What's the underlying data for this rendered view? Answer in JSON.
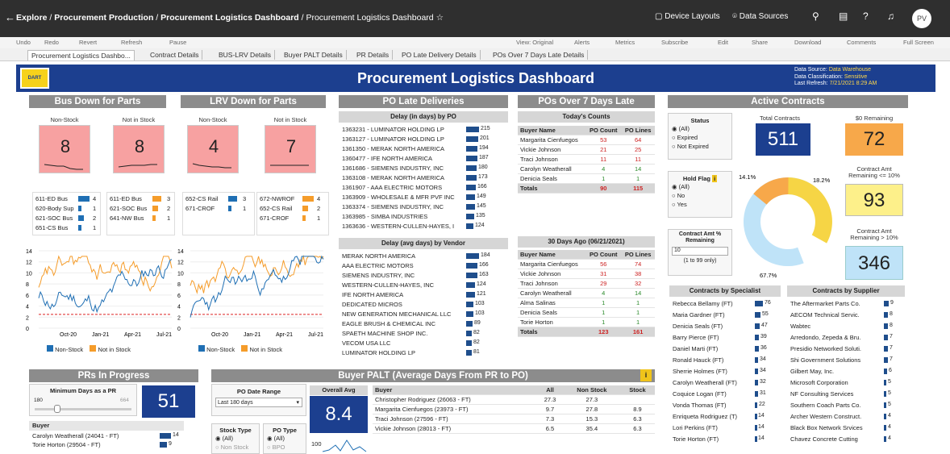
{
  "topbar": {
    "crumb1": "Explore",
    "crumb2": "Procurement Production",
    "crumb3": "Procurement Logistics Dashboard",
    "crumb4": "Procurement Logistics Dashboard",
    "device_layouts": "Device Layouts",
    "data_sources": "Data Sources",
    "avatar": "PV"
  },
  "toolbar": {
    "undo": "Undo",
    "redo": "Redo",
    "revert": "Revert",
    "refresh": "Refresh",
    "pause": "Pause",
    "view_original": "View: Original",
    "alerts": "Alerts",
    "metrics": "Metrics",
    "subscribe": "Subscribe",
    "edit": "Edit",
    "share": "Share",
    "download": "Download",
    "comments": "Comments",
    "full_screen": "Full Screen"
  },
  "tabs": [
    "Procurement Logistics Dashbo...",
    "Contract Details",
    "BUS-LRV Details",
    "Buyer PALT Details",
    "PR Details",
    "PO Late Delivery Details",
    "POs Over 7 Days Late Details"
  ],
  "banner": {
    "logo": "DART",
    "title": "Procurement Logistics Dashboard",
    "source_lbl": "Data Source:",
    "source": "Data Warehouse",
    "class_lbl": "Data Classification:",
    "class": "Sensitive",
    "refresh_lbl": "Last Refresh:",
    "refresh": "7/21/2021 8:29 AM"
  },
  "bus": {
    "title": "Bus Down for Parts",
    "nonstock_lbl": "Non-Stock",
    "notinstock_lbl": "Not in Stock",
    "nonstock": "8",
    "notinstock": "8",
    "list1": [
      [
        "611-ED Bus",
        "4"
      ],
      [
        "620-Body Sup",
        "1"
      ],
      [
        "621-SOC Bus",
        "2"
      ],
      [
        "651-CS Bus",
        "1"
      ]
    ],
    "list2": [
      [
        "611-ED Bus",
        "3"
      ],
      [
        "621-SOC Bus",
        "2"
      ],
      [
        "641-NW Bus",
        "1"
      ]
    ]
  },
  "lrv": {
    "title": "LRV Down for Parts",
    "nonstock_lbl": "Non-Stock",
    "notinstock_lbl": "Not in Stock",
    "nonstock": "4",
    "notinstock": "7",
    "list1": [
      [
        "652-CS Rail",
        "3"
      ],
      [
        "671-CROF",
        "1"
      ]
    ],
    "list2": [
      [
        "672-NWROF",
        "4"
      ],
      [
        "652-CS Rail",
        "2"
      ],
      [
        "671-CROF",
        "1"
      ]
    ]
  },
  "trend": {
    "yticks": [
      "14",
      "12",
      "10",
      "8",
      "6",
      "4",
      "2",
      "0"
    ],
    "xticks": [
      "Oct-20",
      "Jan-21",
      "Apr-21",
      "Jul-21"
    ],
    "legend_ns": "Non-Stock",
    "legend_nis": "Not in Stock"
  },
  "po_late": {
    "title": "PO Late Deliveries",
    "sub1": "Delay (in days) by PO",
    "po_rows": [
      [
        "1363231 - LUMINATOR HOLDING LP",
        "215"
      ],
      [
        "1363127 - LUMINATOR HOLDING LP",
        "201"
      ],
      [
        "1361350 - MERAK NORTH AMERICA",
        "194"
      ],
      [
        "1360477 - IFE NORTH AMERICA",
        "187"
      ],
      [
        "1361686 - SIEMENS INDUSTRY, INC",
        "180"
      ],
      [
        "1363108 - MERAK NORTH AMERICA",
        "173"
      ],
      [
        "1361907 - AAA ELECTRIC MOTORS",
        "166"
      ],
      [
        "1363909 - WHOLESALE & MFR PVF INC",
        "149"
      ],
      [
        "1363374 - SIEMENS INDUSTRY, INC",
        "145"
      ],
      [
        "1363985 - SIMBA INDUSTRIES",
        "135"
      ],
      [
        "1363636 - WESTERN-CULLEN-HAYES, I",
        "124"
      ]
    ],
    "sub2": "Delay (avg days) by Vendor",
    "vendor_rows": [
      [
        "MERAK NORTH AMERICA",
        "184"
      ],
      [
        "AAA ELECTRIC MOTORS",
        "166"
      ],
      [
        "SIEMENS INDUSTRY, INC",
        "163"
      ],
      [
        "WESTERN-CULLEN-HAYES, INC",
        "124"
      ],
      [
        "IFE NORTH AMERICA",
        "121"
      ],
      [
        "DEDICATED MICROS",
        "103"
      ],
      [
        "NEW GENERATION MECHANICAL LLC",
        "103"
      ],
      [
        "EAGLE BRUSH & CHEMICAL INC",
        "89"
      ],
      [
        "SPAETH MACHINE SHOP INC.",
        "82"
      ],
      [
        "VECOM USA LLC",
        "82"
      ],
      [
        "LUMINATOR HOLDING LP",
        "81"
      ]
    ]
  },
  "po7": {
    "title": "POs Over 7 Days Late",
    "today": "Today's Counts",
    "h_buyer": "Buyer Name",
    "h_count": "PO Count",
    "h_lines": "PO Lines",
    "today_rows": [
      [
        "Margarita Cienfuegos",
        "53",
        "64"
      ],
      [
        "Vickie Johnson",
        "21",
        "25"
      ],
      [
        "Traci Johnson",
        "11",
        "11"
      ],
      [
        "Carolyn Weatherall",
        "4",
        "14"
      ],
      [
        "Denicia Seals",
        "1",
        "1"
      ]
    ],
    "today_total": [
      "Totals",
      "90",
      "115"
    ],
    "ago": "30 Days Ago (06/21/2021)",
    "ago_rows": [
      [
        "Margarita Cienfuegos",
        "56",
        "74"
      ],
      [
        "Vickie Johnson",
        "31",
        "38"
      ],
      [
        "Traci Johnson",
        "29",
        "32"
      ],
      [
        "Carolyn Weatherall",
        "4",
        "14"
      ],
      [
        "Alma Salinas",
        "1",
        "1"
      ],
      [
        "Denicia Seals",
        "1",
        "1"
      ],
      [
        "Torie Horton",
        "1",
        "1"
      ]
    ],
    "ago_total": [
      "Totals",
      "123",
      "161"
    ]
  },
  "contracts": {
    "title": "Active Contracts",
    "status_lbl": "Status",
    "status_opts": [
      "(All)",
      "Expired",
      "Not Expired"
    ],
    "hold_lbl": "Hold Flag",
    "hold_opts": [
      "(All)",
      "No",
      "Yes"
    ],
    "amt_lbl": "Contract Amt % Remaining",
    "amt_val": "10",
    "amt_hint": "(1 to 99 only)",
    "total_lbl": "Total Contracts",
    "total": "511",
    "zero_lbl": "$0 Remaining",
    "zero": "72",
    "le_lbl": "Contract Amt Remaining <= 10%",
    "le": "93",
    "gt_lbl": "Contract Amt Remaining > 10%",
    "gt": "346",
    "donut": {
      "a": "14.1%",
      "b": "18.2%",
      "c": "67.7%"
    },
    "spec_title": "Contracts by Specialist",
    "spec_rows": [
      [
        "Rebecca Bellamy (FT)",
        "76"
      ],
      [
        "Maria Gardner (FT)",
        "55"
      ],
      [
        "Denicia Seals (FT)",
        "47"
      ],
      [
        "Barry Pierce (FT)",
        "39"
      ],
      [
        "Daniel Marti (FT)",
        "36"
      ],
      [
        "Ronald Hauck (FT)",
        "34"
      ],
      [
        "Sherrie Holmes (FT)",
        "34"
      ],
      [
        "Carolyn Weatherall (FT)",
        "32"
      ],
      [
        "Coquice Logan (FT)",
        "31"
      ],
      [
        "Vonda Thomas (FT)",
        "22"
      ],
      [
        "Enriqueta Rodriguez (T)",
        "14"
      ],
      [
        "Lori Perkins (FT)",
        "14"
      ],
      [
        "Torie Horton (FT)",
        "14"
      ]
    ],
    "supp_title": "Contracts by Supplier",
    "supp_rows": [
      [
        "The Aftermarket Parts Co.",
        "9"
      ],
      [
        "AECOM Technical Servic.",
        "8"
      ],
      [
        "Wabtec",
        "8"
      ],
      [
        "Arredondo, Zepeda & Bru.",
        "7"
      ],
      [
        "Presidio Networked Soluti.",
        "7"
      ],
      [
        "Shi Government Solutions",
        "7"
      ],
      [
        "Gilbert May, Inc.",
        "6"
      ],
      [
        "Microsoft Corporation",
        "5"
      ],
      [
        "NF Consulting Services",
        "5"
      ],
      [
        "Southern Coach Parts Co.",
        "5"
      ],
      [
        "Archer Western Construct.",
        "4"
      ],
      [
        "Black Box Network Srvices",
        "4"
      ],
      [
        "Chavez Concrete Cutting",
        "4"
      ]
    ]
  },
  "prs": {
    "title": "PRs In Progress",
    "min_lbl": "Minimum Days as a PR",
    "min_from": "180",
    "min_to": "664",
    "big": "51",
    "buyer_lbl": "Buyer",
    "rows": [
      [
        "Carolyn Weatherall (24041 - FT)",
        "14"
      ],
      [
        "Torie Horton (29504 - FT)",
        "9"
      ]
    ]
  },
  "palt": {
    "title": "Buyer PALT (Average Days From PR to PO)",
    "range_lbl": "PO Date Range",
    "range_val": "Last 180 days",
    "stock_lbl": "Stock Type",
    "stock_opts": [
      "(All)",
      "Non Stock"
    ],
    "potype_lbl": "PO Type",
    "potype_opts": [
      "(All)",
      "BPO"
    ],
    "overall_lbl": "Overall Avg",
    "overall": "8.4",
    "axis100": "100",
    "h_buyer": "Buyer",
    "h_all": "All",
    "h_ns": "Non Stock",
    "h_stock": "Stock",
    "rows": [
      [
        "Christopher Rodriguez (26063 - FT)",
        "27.3",
        "27.3",
        ""
      ],
      [
        "Margarita Cienfuegos (23973 - FT)",
        "9.7",
        "27.8",
        "8.9"
      ],
      [
        "Traci Johnson (27596 - FT)",
        "7.3",
        "15.3",
        "6.3"
      ],
      [
        "Vickie Johnson (28013 - FT)",
        "6.5",
        "35.4",
        "6.3"
      ]
    ]
  },
  "colors": {
    "navy": "#1c3f8f",
    "orange": "#f7a84a",
    "pink": "#f7a1a1",
    "header": "#8c8c8c"
  }
}
